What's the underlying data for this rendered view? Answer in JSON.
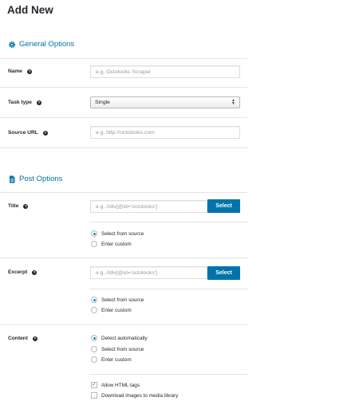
{
  "page": {
    "title": "Add New"
  },
  "general": {
    "heading": "General Options",
    "name_label": "Name",
    "name_placeholder": "e.g. Octolooks Scraper",
    "task_type_label": "Task type",
    "task_type_value": "Single",
    "source_url_label": "Source URL",
    "source_url_placeholder": "e.g. http://octolooks.com"
  },
  "post": {
    "heading": "Post Options",
    "title": {
      "label": "Title",
      "placeholder": "e.g. //div[@id='octolooks']",
      "button": "Select",
      "options": [
        "Select from source",
        "Enter custom"
      ],
      "selected": 0
    },
    "excerpt": {
      "label": "Excerpt",
      "placeholder": "e.g. //div[@id='octolooks']",
      "button": "Select",
      "options": [
        "Select from source",
        "Enter custom"
      ],
      "selected": 0
    },
    "content": {
      "label": "Content",
      "options": [
        "Detect automatically",
        "Select from source",
        "Enter custom"
      ],
      "selected": 0,
      "checkboxes": [
        {
          "label": "Allow HTML tags",
          "checked": true
        },
        {
          "label": "Download images to media library",
          "checked": false
        }
      ]
    }
  },
  "colors": {
    "accent": "#0073aa",
    "radio_dot": "#1e8cbe"
  }
}
